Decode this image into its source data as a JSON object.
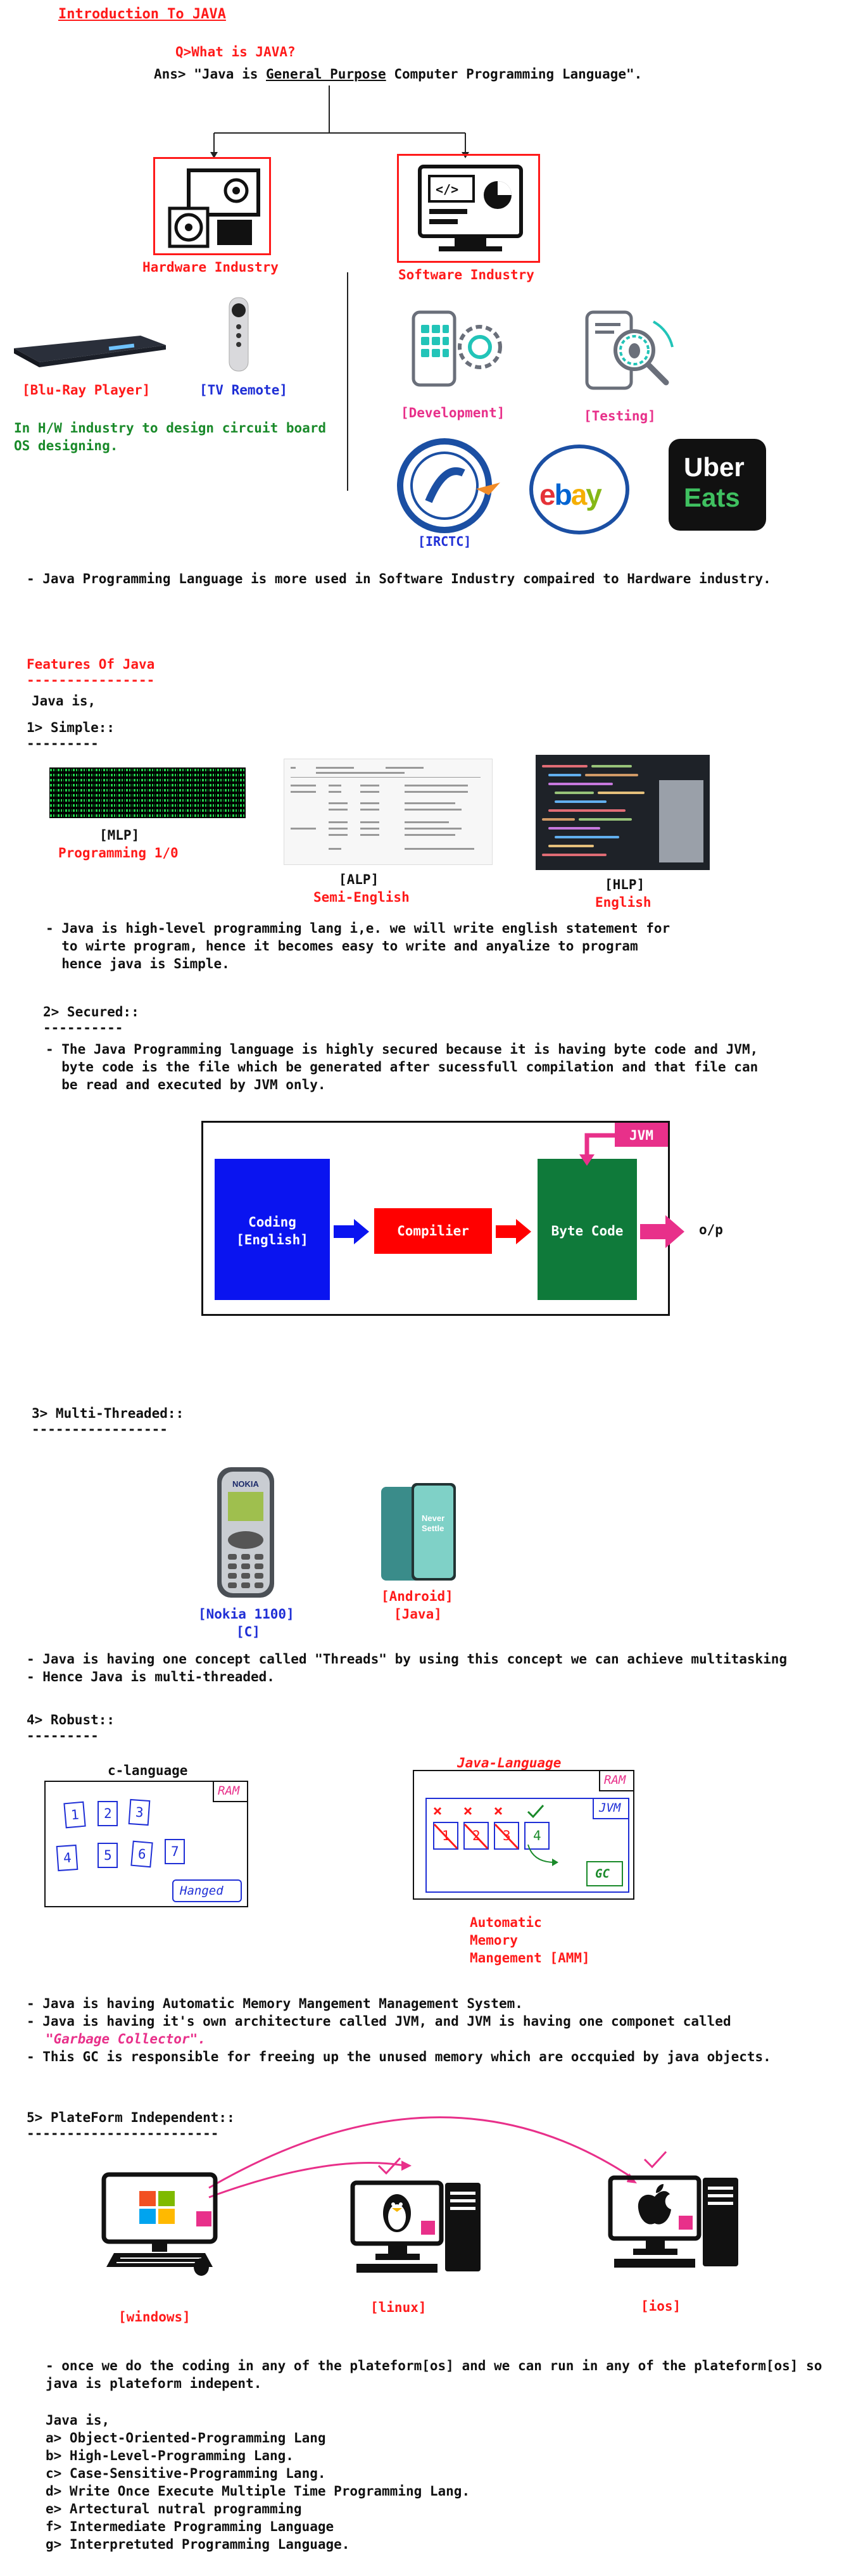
{
  "intro": {
    "title": "Introduction To JAVA",
    "question": "Q>What is JAVA?",
    "answer_prefix": "Ans> \"Java is ",
    "answer_underlined": "General Purpose",
    "answer_suffix": " Computer Programming Language\"."
  },
  "industry": {
    "hardware": "Hardware Industry",
    "software": "Software Industry",
    "bluray": "[Blu-Ray Player]",
    "tvremote": "[TV Remote]",
    "hw_note1": "In H/W industry to design circuit board",
    "hw_note2": "OS designing.",
    "development": "[Development]",
    "testing": "[Testing]",
    "irctc": "[IRCTC]",
    "ebay": "ebay",
    "uber1": "Uber",
    "uber2": "Eats",
    "summary": "- Java Programming Language is more used in Software Industry compaired to Hardware industry."
  },
  "features": {
    "title": "Features Of Java",
    "title_rule": "----------------",
    "java_is": "Java is,",
    "simple": {
      "heading": "1> Simple::",
      "rule": "---------",
      "mlp": "[MLP]",
      "mlp_sub": "Programming 1/0",
      "alp": "[ALP]",
      "alp_sub": "Semi-English",
      "hlp": "[HLP]",
      "hlp_sub": "English",
      "desc": [
        "- Java is high-level programming lang i,e. we will write english statement for",
        "  to wirte program, hence it becomes easy to write and anyalize to program",
        "  hence java is Simple."
      ]
    },
    "secured": {
      "heading": "2> Secured::",
      "rule": "----------",
      "desc": [
        "- The Java Programming language is highly secured because it is having byte code and JVM,",
        "  byte code is the file which be generated after sucessfull compilation and that file can",
        "  be read and executed by JVM only."
      ],
      "coding": "Coding",
      "coding2": "[English]",
      "compiler": "Compilier",
      "bytecode": "Byte Code",
      "jvm": "JVM",
      "op": "o/p"
    },
    "multithreaded": {
      "heading": "3> Multi-Threaded::",
      "rule": "-----------------",
      "nokia": "[Nokia 1100]",
      "nokia_sub": "[C]",
      "android": "[Android]",
      "android_sub": "[Java]",
      "phone_brand": "NOKIA",
      "android_screen1": "Never",
      "android_screen2": "Settle",
      "desc": [
        "- Java is having one concept called \"Threads\" by using this concept we can achieve multitasking",
        "- Hence Java is multi-threaded."
      ]
    },
    "robust": {
      "heading": "4> Robust::",
      "rule": "---------",
      "c_lang": "c-language",
      "java_lang": "Java-Language",
      "ram": "RAM",
      "hanged": "Hanged",
      "jvm": "JVM",
      "gc": "GC",
      "c_blocks": [
        "1",
        "2",
        "3",
        "4",
        "5",
        "6",
        "7"
      ],
      "java_blocks": [
        "1",
        "2",
        "3",
        "4"
      ],
      "amm": [
        "Automatic",
        "Memory",
        "Mangement [AMM]"
      ],
      "desc1": "- Java is having Automatic Memory Mangement Management System.",
      "desc2": "- Java is having it's own architecture called JVM, and JVM is having one componet called",
      "desc3": "\"Garbage Collector\".",
      "desc4": "- This GC is responsible for freeing up the unused memory which are occquied by java objects."
    },
    "platform": {
      "heading": "5> PlateForm Independent::",
      "rule": "------------------------",
      "windows": "[windows]",
      "linux": "[linux]",
      "ios": "[ios]",
      "desc": [
        "- once we do the coding in any of the plateform[os] and we can run in any of the plateform[os] so",
        "java is plateform indepent."
      ]
    },
    "summary": {
      "intro": "Java is,",
      "items": [
        "a> Object-Oriented-Programming Lang",
        "b> High-Level-Programming Lang.",
        "c> Case-Sensitive-Programming Lang.",
        "d> Write Once Execute Multiple Time Programming Lang.",
        "e> Artectural nutral programming",
        "f> Intermediate Programming Language",
        "g> Interpretuted Programming Language."
      ]
    }
  },
  "colors": {
    "red": "#ff1a1a",
    "blue": "#1f2fd6",
    "green": "#1a8a2a",
    "pink": "#e8308a",
    "flow_blue": "#0a14f0",
    "flow_red": "#ff0000",
    "flow_green": "#0f7a3a"
  }
}
